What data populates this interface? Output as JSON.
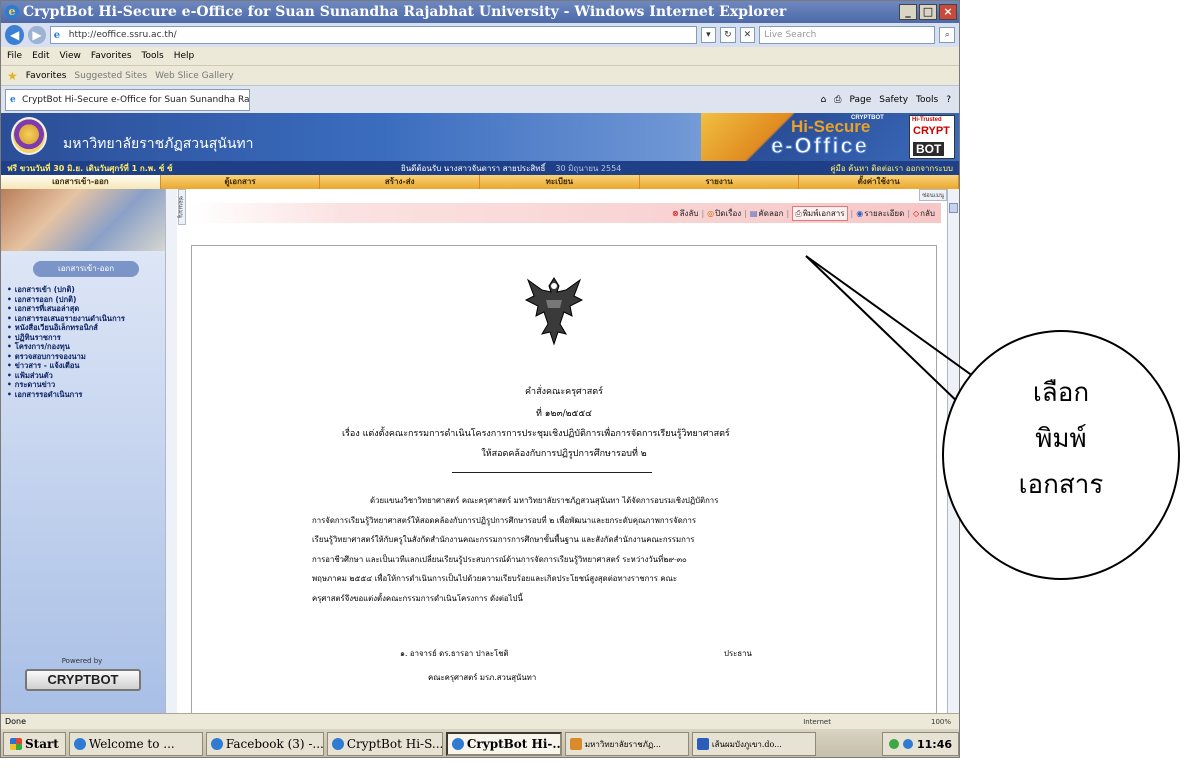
{
  "browser": {
    "title": "CryptBot Hi-Secure e-Office for Suan Sunandha Rajabhat University - Windows Internet Explorer",
    "url": "http://eoffice.ssru.ac.th/",
    "search_placeholder": "Live Search",
    "menu": [
      "File",
      "Edit",
      "View",
      "Favorites",
      "Tools",
      "Help"
    ],
    "favorites_label": "Favorites",
    "favorites_items": [
      "Suggested Sites",
      "Web Slice Gallery"
    ],
    "tab_label": "CryptBot Hi-Secure e-Office for Suan Sunandha Rajabh...",
    "command_bar": [
      "Page",
      "Safety",
      "Tools"
    ],
    "window_buttons": [
      "_",
      "□",
      "×"
    ],
    "status": "Done",
    "zone": "Internet",
    "zoom": "100%"
  },
  "site": {
    "university_name": "มหาวิทยาลัยราชภัฏสวนสุนันทา",
    "logo": {
      "brand_top": "CRYPTBOT",
      "secure": "Hi-Secure",
      "office": "e-Office",
      "badge_top": "Hi-Trusted",
      "badge_crypt": "CRYPT",
      "badge_bot": "BOT"
    },
    "date_line": "ฟรี ขวนวันที่ 30 มิ.ย. เดินวันศุกร์ที่ 1 ก.พ. ซ์ ซ์",
    "user_line": "ยินดีต้อนรับ นางสาวจันดารา สายประสิทธิ์",
    "date_stamp": "30 มิถุนายน 2554",
    "user_links": "คู่มือ  ค้นหา  ติดต่อเรา  ออกจากระบบ",
    "main_nav": [
      "เอกสารเข้า-ออก",
      "ตู้เอกสาร",
      "สร้าง-ส่ง",
      "ทะเบียน",
      "รายงาน",
      "ตั้งค่าใช้งาน"
    ],
    "sidebar_heading": "เอกสารเข้า-ออก",
    "sidebar_items": [
      "เอกสารเข้า (ปกติ)",
      "เอกสารออก (ปกติ)",
      "เอกสารที่เสนอล่าสุด",
      "เอกสารรอเสนอรายงานดำเนินการ",
      "หนังสือเวียนอิเล็กทรอนิกส์",
      "ปฏิทินราชการ",
      "โครงการ/กองทุน",
      "ตรวจสอบการจองนาม",
      "ข่าวสาร - แจ้งเตือน",
      "แฟ้มส่วนตัว",
      "กระดานข่าว",
      "เอกสารรอดำเนินการ"
    ],
    "powered_by": "Powered by",
    "powered_brand": "CRYPTBOT",
    "side_toggle": "ซ่อนเมนู",
    "top_marker": "ซ่อนเมนู"
  },
  "toolbar": {
    "delete": "ลึงลับ",
    "close": "ปิดเรื่อง",
    "copy": "คัดลอก",
    "print": "พิมพ์เอกสาร",
    "back_detail": "รายละเอียด",
    "back": "กลับ"
  },
  "document": {
    "title": "คำสั่งคณะครุศาสตร์",
    "number": "ที่   ๑๒๓/๒๕๕๔",
    "subject": "เรื่อง  แต่งตั้งคณะกรรมการดำเนินโครงการการประชุมเชิงปฏิบัติการเพื่อการจัดการเรียนรู้วิทยาศาสตร์",
    "subject_line2": "ให้สอดคล้องกับการปฏิรูปการศึกษารอบที่ ๒",
    "paragraph": [
      "ด้วยแขนงวิชาวิทยาศาสตร์ คณะครุศาสตร์ มหาวิทยาลัยราชภัฏสวนสุนันทา ได้จัดการอบรมเชิงปฏิบัติการ",
      "การจัดการเรียนรู้วิทยาศาสตร์ให้สอดคล้องกับการปฏิรูปการศึกษารอบที่ ๒ เพื่อพัฒนาและยกระดับคุณภาพการจัดการ",
      "เรียนรู้วิทยาศาสตร์ให้กับครูในสังกัดสำนักงานคณะกรรมการการศึกษาขั้นพื้นฐาน และสังกัดสำนักงานคณะกรรมการ",
      "การอาชีวศึกษา และเป็นเวทีแลกเปลี่ยนเรียนรู้ประสบการณ์ด้านการจัดการเรียนรู้วิทยาศาสตร์ ระหว่างวันที่๒๙-๓๐",
      "พฤษภาคม ๒๕๕๔ เพื่อให้การดำเนินการเป็นไปด้วยความเรียบร้อยและเกิดประโยชน์สูงสุดต่อทางราชการ คณะ",
      "ครุศาสตร์จึงขอแต่งตั้งคณะกรรมการดำเนินโครงการ ดังต่อไปนี้"
    ],
    "member_name": "๑. อาจารย์ ดร.ธารอา ปาละโชติ",
    "member_role": "ประธาน",
    "member_affiliation": "คณะครุศาสตร์ มรภ.สวนสุนันทา"
  },
  "taskbar": {
    "start": "Start",
    "items": [
      "Welcome to ...",
      "Facebook (3) -...",
      "CryptBot Hi-S...",
      "CryptBot Hi-...",
      "มหาวิทยาลัยราชภัฏ...",
      "เส้นผมบังภูเขา.do..."
    ],
    "clock": "11:46"
  },
  "callout": {
    "lines": [
      "เลือก",
      "พิมพ์",
      "เอกสาร"
    ]
  }
}
